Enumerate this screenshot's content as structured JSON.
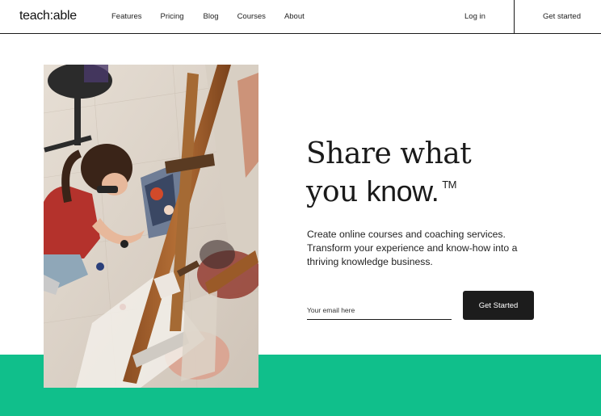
{
  "header": {
    "logo": "teach:able",
    "nav": [
      "Features",
      "Pricing",
      "Blog",
      "Courses",
      "About"
    ],
    "login": "Log in",
    "get_started": "Get started"
  },
  "hero": {
    "headline_line1": "Share what",
    "headline_line2_a": "you ",
    "headline_line2_b": "know.",
    "trademark": "TM",
    "subtext_lines": [
      "Create online courses and coaching services.",
      "Transform your experience and know-how into a",
      "thriving knowledge business."
    ],
    "email_placeholder": "Your email here",
    "cta_label": "Get Started"
  },
  "colors": {
    "accent_green": "#10bf8b",
    "button_dark": "#1c1c1c"
  }
}
